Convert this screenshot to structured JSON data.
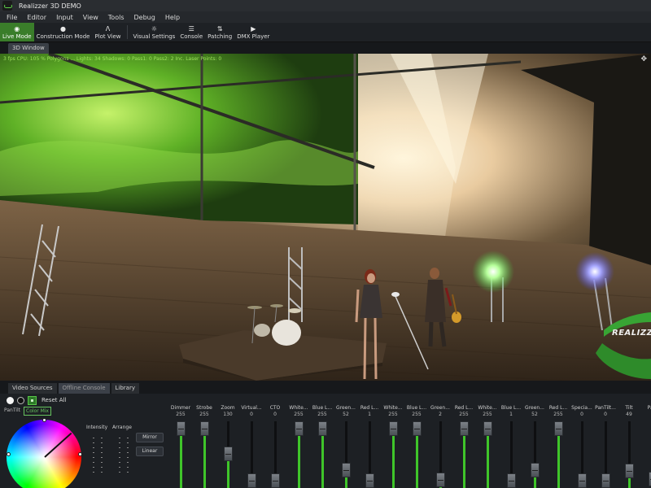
{
  "window": {
    "title": "Realizzer 3D DEMO"
  },
  "menu": [
    "File",
    "Editor",
    "Input",
    "View",
    "Tools",
    "Debug",
    "Help"
  ],
  "toolbar": {
    "live_mode": "Live Mode",
    "construction_mode": "Construction Mode",
    "plot_view": "Plot View",
    "visual_settings": "Visual Settings",
    "console": "Console",
    "patching": "Patching",
    "dmx_player": "DMX Player"
  },
  "viewport": {
    "tab_label": "3D Window",
    "stats": "3 fps CPU: 105 %  Polygons  ...  Lights: 34  Shadows: 0  Pass1: 0  Pass2: 2  Inc. Laser Points: 0",
    "brand_label": "REALIZZ"
  },
  "bottom_tabs": [
    "Video Sources",
    "Offline Console",
    "Library"
  ],
  "bottom_tabs_active": 1,
  "console": {
    "reset_all": "Reset All",
    "subtabs": [
      "PanTilt",
      "Color Mix"
    ],
    "intensity_label": "Intensity",
    "arrange_label": "Arrange",
    "mirror_label": "Mirror",
    "linear_label": "Linear",
    "colors": {
      "fader_fill": "#3fc52a",
      "accent": "#66c35e"
    },
    "faders": [
      {
        "name": "Dimmer",
        "value": "255",
        "level": 255
      },
      {
        "name": "Strobe",
        "value": "255",
        "level": 255
      },
      {
        "name": "Zoom",
        "value": "130",
        "level": 130
      },
      {
        "name": "Virtual...",
        "value": "0",
        "level": 0
      },
      {
        "name": "CTO",
        "value": "0",
        "level": 0
      },
      {
        "name": "White...",
        "value": "255",
        "level": 255
      },
      {
        "name": "Blue L...",
        "value": "255",
        "level": 255
      },
      {
        "name": "Green...",
        "value": "52",
        "level": 52
      },
      {
        "name": "Red L...",
        "value": "1",
        "level": 1
      },
      {
        "name": "White...",
        "value": "255",
        "level": 255
      },
      {
        "name": "Blue L...",
        "value": "255",
        "level": 255
      },
      {
        "name": "Green...",
        "value": "2",
        "level": 2
      },
      {
        "name": "Red L...",
        "value": "255",
        "level": 255
      },
      {
        "name": "White...",
        "value": "255",
        "level": 255
      },
      {
        "name": "Blue L...",
        "value": "1",
        "level": 1
      },
      {
        "name": "Green...",
        "value": "52",
        "level": 52
      },
      {
        "name": "Red L...",
        "value": "255",
        "level": 255
      },
      {
        "name": "Specia...",
        "value": "0",
        "level": 0
      },
      {
        "name": "PanTilt...",
        "value": "0",
        "level": 0
      },
      {
        "name": "Tilt",
        "value": "49",
        "level": 49
      },
      {
        "name": "Pa...",
        "value": "7",
        "level": 7
      }
    ]
  }
}
